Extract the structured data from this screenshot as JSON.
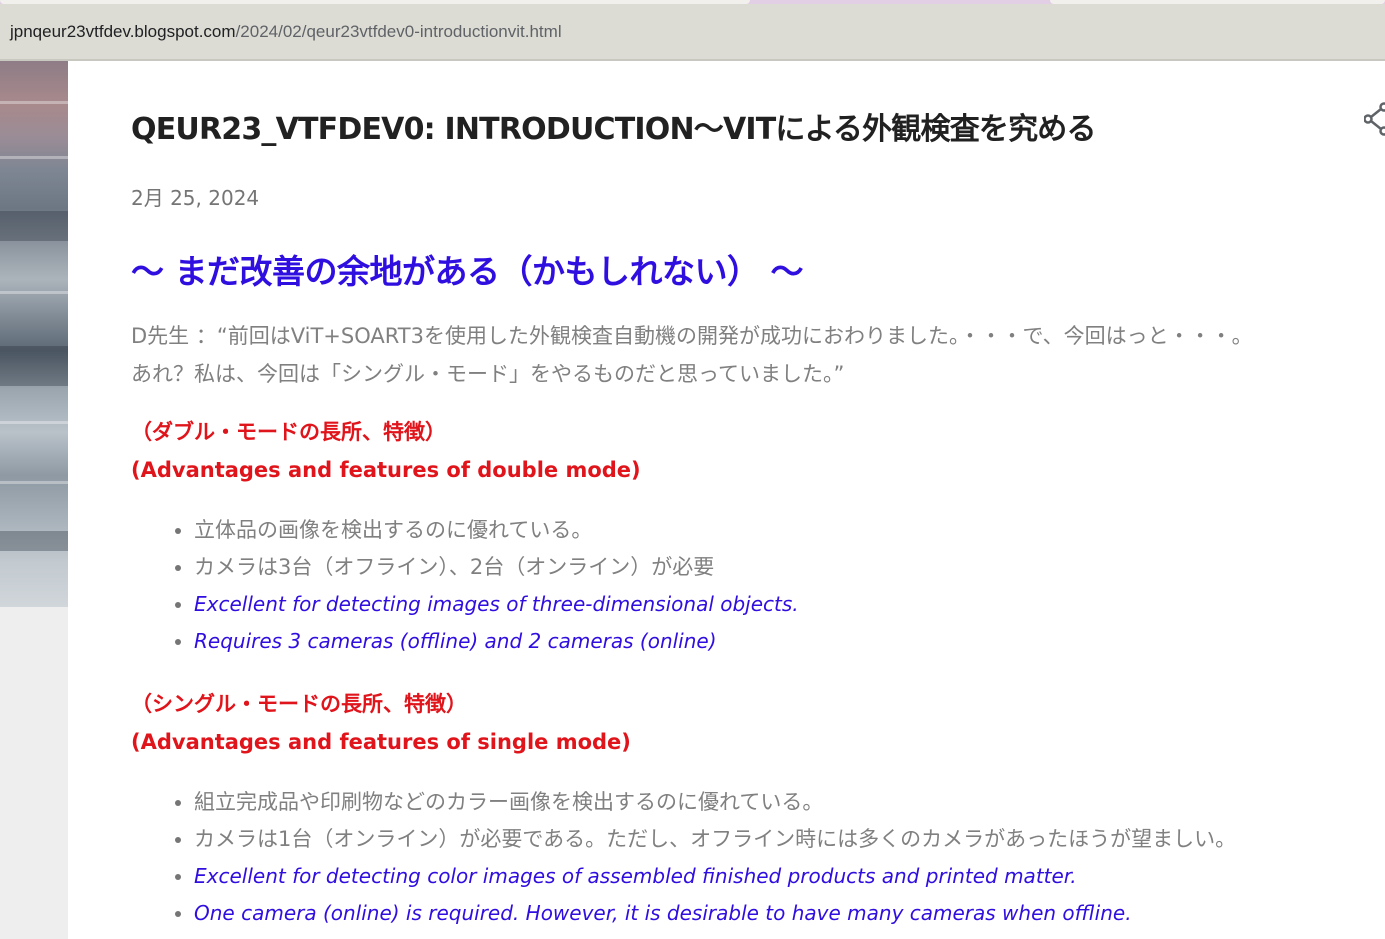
{
  "browser": {
    "url_host": "jpnqeur23vtfdev.blogspot.com",
    "url_path": "/2024/02/qeur23vtfdev0-introductionvit.html"
  },
  "post": {
    "title": "QEUR23_VTFDEV0: INTRODUCTION～VITによる外観検査を究める",
    "date": "2月 25, 2024",
    "headline": "～ まだ改善の余地がある（かもしれない） ～",
    "dialogue": [
      "D先生 ：“前回はViT+SOART3を使用した外観検査自動機の開発が成功におわりました。・・・で、今回はっと・・・。",
      "あれ？私は、今回は「シングル・モード」をやるものだと思っていました。”"
    ],
    "double_mode": {
      "heading_jp": "（ダブル・モードの長所、特徴）",
      "heading_en": "(Advantages and features of double mode)",
      "points": [
        "立体品の画像を検出するのに優れている。",
        "カメラは3台（オフライン）、2台（オンライン）が必要",
        "Excellent for detecting images of three-dimensional objects.",
        "Requires 3 cameras (offline) and 2 cameras (online)"
      ]
    },
    "single_mode": {
      "heading_jp": "（シングル・モードの長所、特徴）",
      "heading_en": "(Advantages and features of single mode)",
      "points": [
        "組立完成品や印刷物などのカラー画像を検出するのに優れている。",
        "カメラは1台（オンライン）が必要である。ただし、オフライン時には多くのカメラがあったほうが望ましい。",
        "Excellent for detecting color images of assembled finished products and printed matter.",
        "One camera (online) is required. However, it is desirable to have many cameras when offline."
      ]
    }
  },
  "icons": {
    "share": "share-icon"
  },
  "colors": {
    "title": "#212121",
    "headline": "#2f0ee0",
    "section_heading": "#e0141b",
    "body_text": "#808080",
    "english_text": "#2f0ee0",
    "address_bar": "#dddcd4"
  }
}
